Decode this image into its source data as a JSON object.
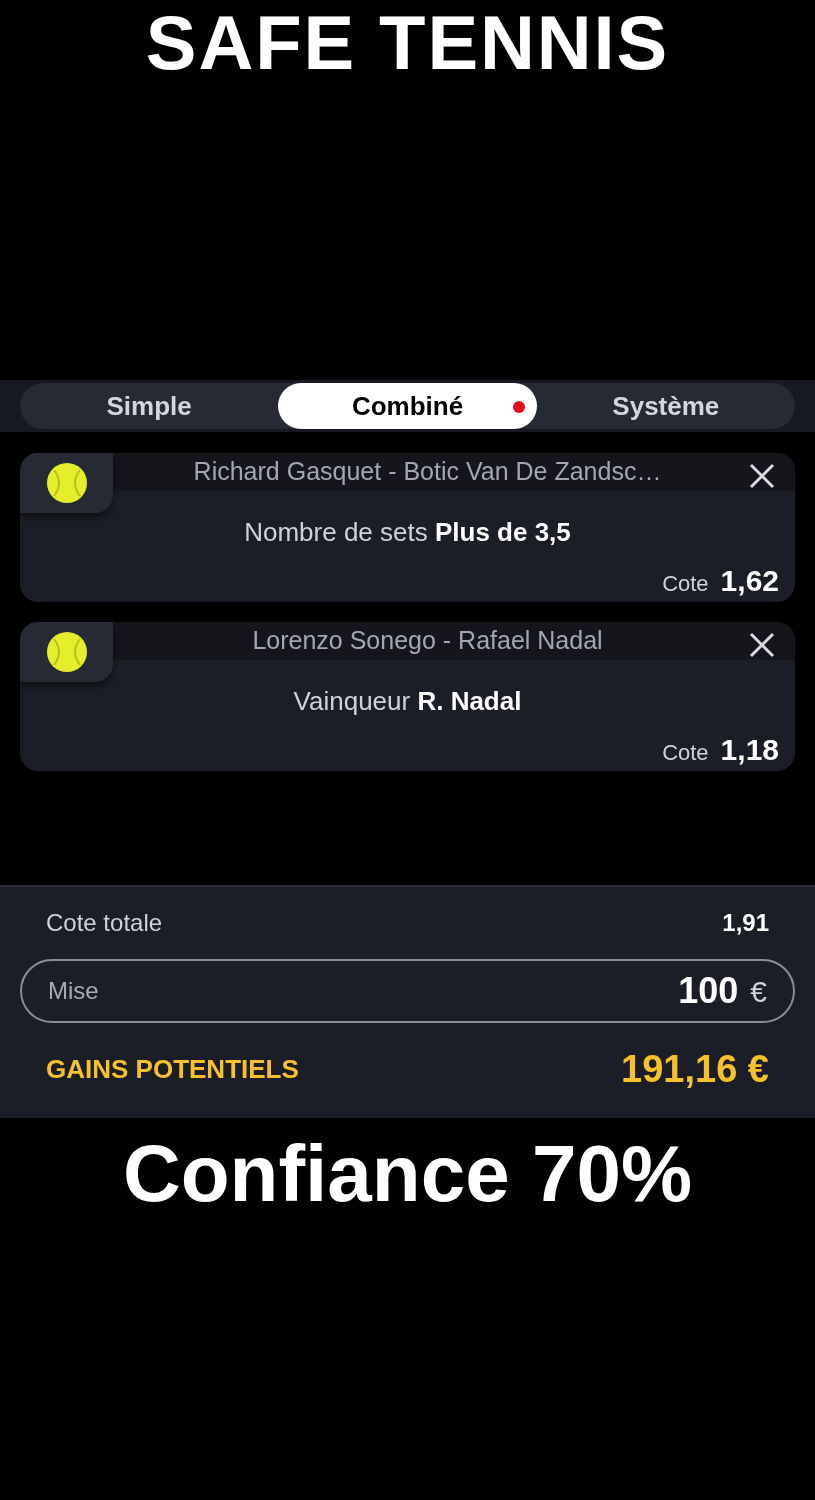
{
  "headline": "SAFE TENNIS",
  "tabs": [
    {
      "label": "Simple",
      "selected": false,
      "dot": false
    },
    {
      "label": "Combiné",
      "selected": true,
      "dot": true
    },
    {
      "label": "Système",
      "selected": false,
      "dot": false
    }
  ],
  "bets": [
    {
      "match": "Richard Gasquet - Botic Van De Zandsc…",
      "selection": "Nombre de sets **Plus de 3,5**",
      "odds_label": "Cote",
      "odds": "1,62"
    },
    {
      "match": "Lorenzo Sonego - Rafael Nadal",
      "selection": "Vainqueur **R. Nadal**",
      "odds_label": "Cote",
      "odds": "1,18"
    }
  ],
  "summary": {
    "total_label": "Cote totale",
    "total": "1,91",
    "stake_label": "Mise",
    "stake": "100",
    "currency": "€",
    "gains_label": "GAINS POTENTIELS",
    "gains": "191,16 €"
  },
  "footer": "Confiance 70%"
}
